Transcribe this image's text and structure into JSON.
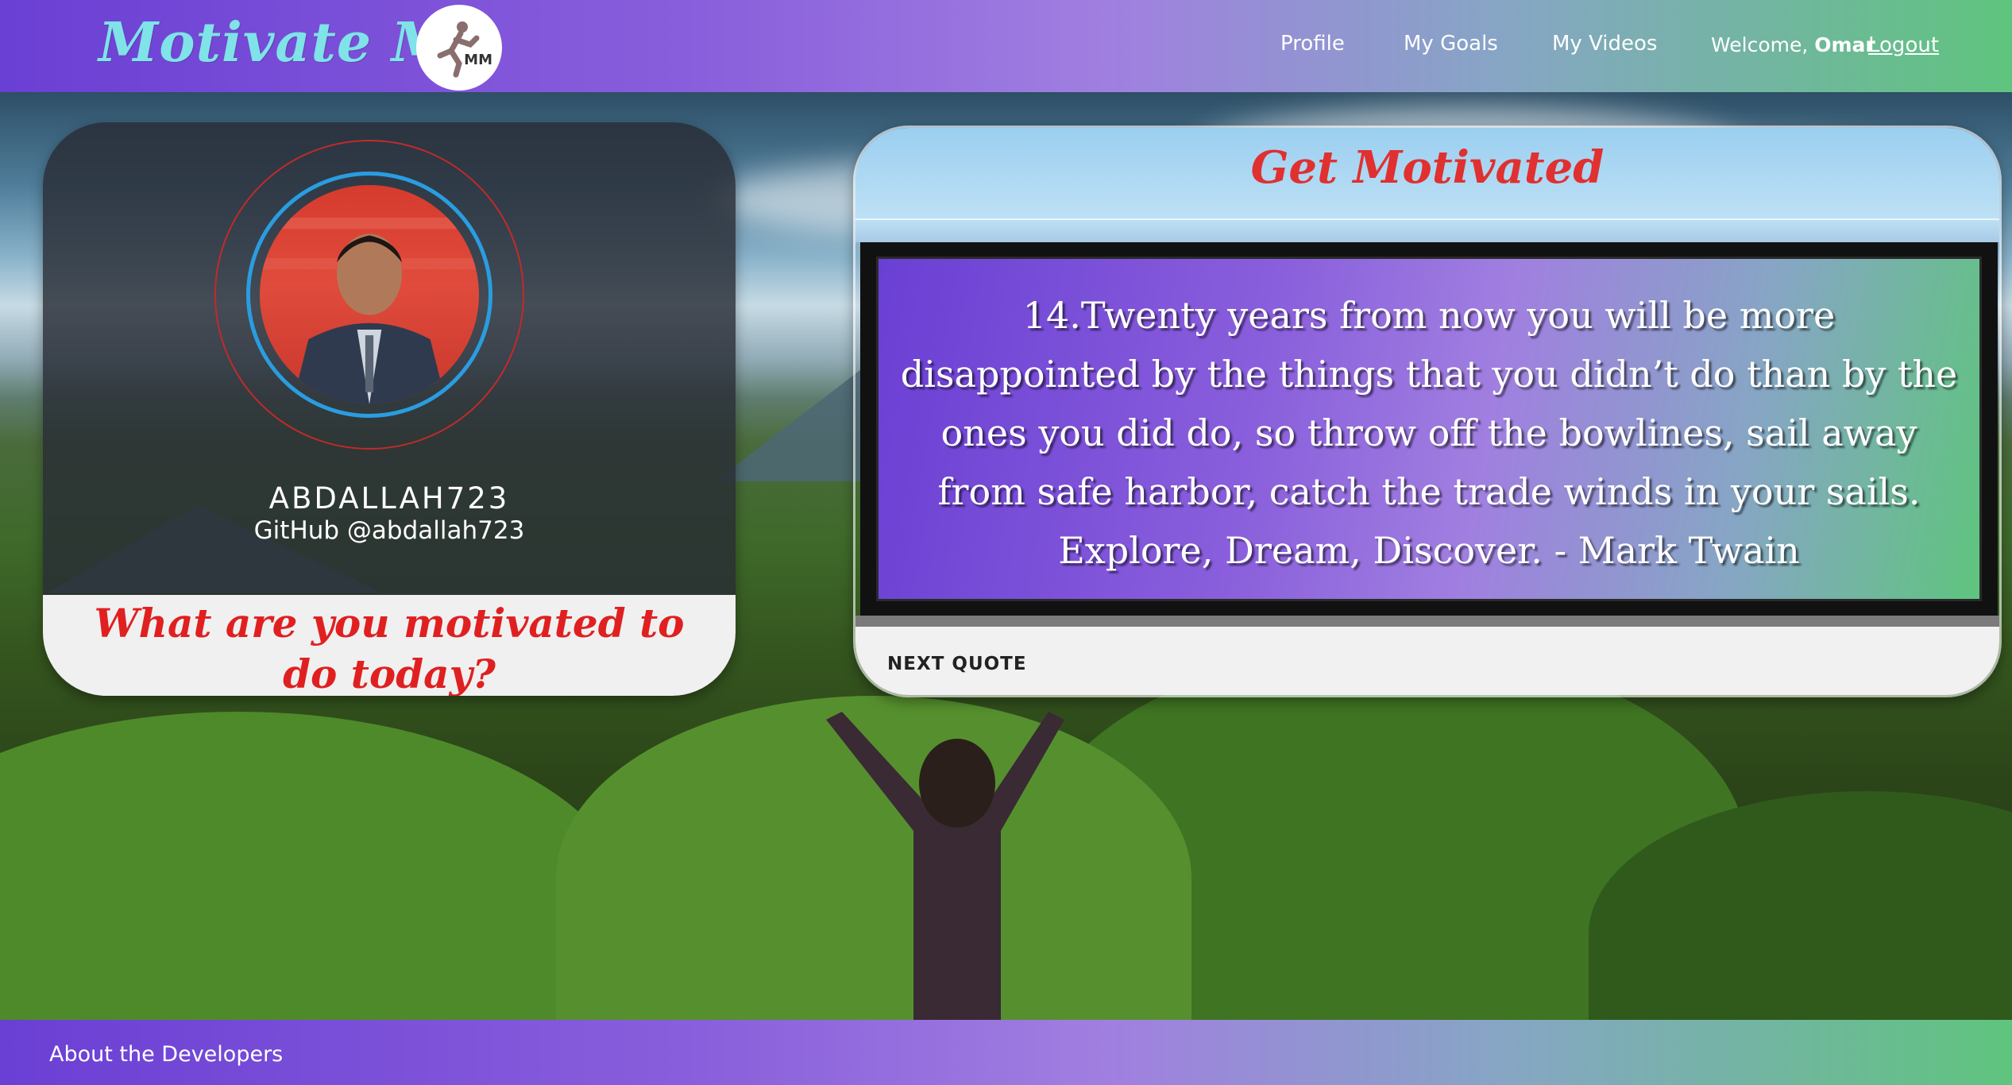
{
  "nav": {
    "brand": "Motivate Me",
    "logo_text": "MM",
    "links": [
      "Profile",
      "My Goals",
      "My Videos"
    ],
    "welcome_prefix": "Welcome, ",
    "user_name": "Omar",
    "logout": "Logout"
  },
  "profile": {
    "username": "ABDALLAH723",
    "github": "GitHub @abdallah723",
    "prompt": "What are you motivated to do today?"
  },
  "quote": {
    "title": "Get Motivated",
    "text": "14.Twenty years from now you will be more disappointed by the things that you didn’t do than by the ones you did do, so throw off the bowlines, sail away from safe harbor, catch the trade winds in your sails. Explore, Dream, Discover. - Mark Twain",
    "next_button": "NEXT QUOTE"
  },
  "footer": {
    "about": "About the Developers"
  },
  "colors": {
    "nav_gradient_start": "#6a3fd4",
    "nav_gradient_mid": "#a07fe0",
    "nav_gradient_end": "#5fc47e",
    "brand_text": "#7fe3e8",
    "accent_red": "#e02020",
    "ring_blue": "#2a9de0"
  }
}
